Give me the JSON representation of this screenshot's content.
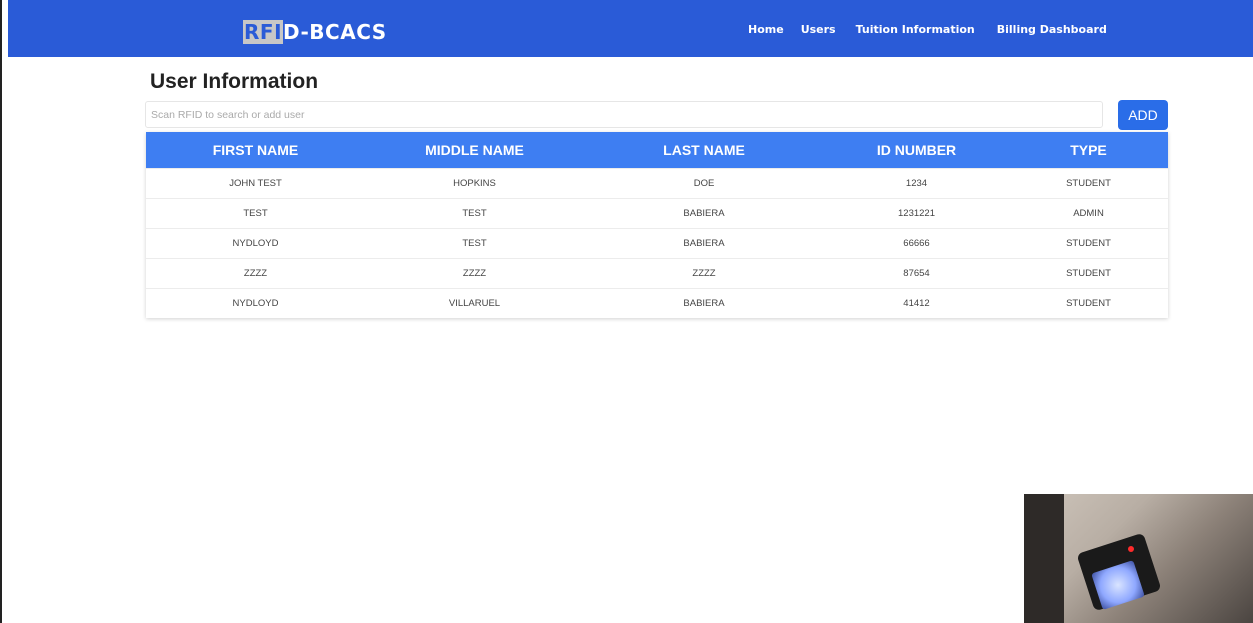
{
  "navbar": {
    "brand_highlight": "RFI",
    "brand_rest": "D-BCACS",
    "links": [
      "Home",
      "Users",
      "Tuition Information",
      "Billing Dashboard"
    ]
  },
  "page": {
    "title": "User Information"
  },
  "search": {
    "placeholder": "Scan RFID to search or add user",
    "value": ""
  },
  "add_button": "ADD",
  "table": {
    "headers": [
      "FIRST NAME",
      "MIDDLE NAME",
      "LAST NAME",
      "ID NUMBER",
      "TYPE"
    ],
    "rows": [
      [
        "JOHN TEST",
        "HOPKINS",
        "DOE",
        "1234",
        "STUDENT"
      ],
      [
        "TEST",
        "TEST",
        "BABIERA",
        "1231221",
        "ADMIN"
      ],
      [
        "NYDLOYD",
        "TEST",
        "BABIERA",
        "66666",
        "STUDENT"
      ],
      [
        "ZZZZ",
        "ZZZZ",
        "ZZZZ",
        "87654",
        "STUDENT"
      ],
      [
        "NYDLOYD",
        "VILLARUEL",
        "BABIERA",
        "41412",
        "STUDENT"
      ]
    ]
  },
  "colors": {
    "navbar": "#2a5bd7",
    "table_header": "#3e7ef2",
    "add_button": "#2a6de8"
  }
}
